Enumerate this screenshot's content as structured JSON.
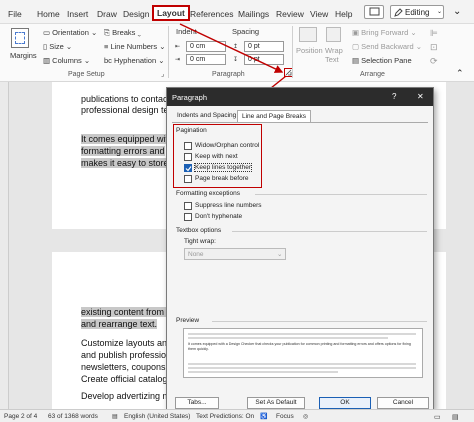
{
  "menu": {
    "items": [
      "File",
      "Home",
      "Insert",
      "Draw",
      "Design",
      "Layout",
      "References",
      "Mailings",
      "Review",
      "View",
      "Help"
    ],
    "active": "Layout",
    "editing_label": "Editing"
  },
  "ribbon": {
    "margins": "Margins",
    "orientation": "Orientation",
    "size": "Size",
    "columns": "Columns",
    "breaks": "Breaks",
    "line_numbers": "Line Numbers",
    "hyphenation": "Hyphenation",
    "page_setup_group": "Page Setup",
    "indent_label": "Indent",
    "spacing_label": "Spacing",
    "indent_left": "0 cm",
    "indent_right": "0 cm",
    "spacing_before": "0 pt",
    "spacing_after": "0 pt",
    "paragraph_group": "Paragraph",
    "position": "Position",
    "wrap_text": "Wrap Text",
    "bring_forward": "Bring Forward",
    "send_backward": "Send Backward",
    "selection_pane": "Selection Pane",
    "arrange_group": "Arrange"
  },
  "document": {
    "page1_lines": [
      "publications to contacts",
      "professional design te",
      "It comes equipped with",
      "formatting errors and",
      "makes it easy to store"
    ],
    "page2_lines": [
      "existing content from o",
      "and rearrange text.",
      "Customize layouts and",
      "and publish profession",
      "newsletters, coupons,",
      "Create official catalogu",
      "Develop advertizing ma"
    ]
  },
  "dialog": {
    "title": "Paragraph",
    "help": "?",
    "close": "✕",
    "tabs": [
      "Indents and Spacing",
      "Line and Page Breaks"
    ],
    "active_tab": "Line and Page Breaks",
    "pagination_label": "Pagination",
    "pagination": [
      {
        "label": "Widow/Orphan control",
        "checked": false
      },
      {
        "label": "Keep with next",
        "checked": false
      },
      {
        "label": "Keep lines together",
        "checked": true
      },
      {
        "label": "Page break before",
        "checked": false
      }
    ],
    "formatting_label": "Formatting exceptions",
    "formatting": [
      {
        "label": "Suppress line numbers",
        "checked": false
      },
      {
        "label": "Don't hyphenate",
        "checked": false
      }
    ],
    "textbox_label": "Textbox options",
    "tight_wrap_label": "Tight wrap:",
    "tight_wrap_value": "None",
    "preview_label": "Preview",
    "preview_text": "It comes equipped with a Design Checker that checks your publication for common printing and formatting errors and offers options for fixing them quickly.",
    "buttons": {
      "tabs": "Tabs...",
      "default": "Set As Default",
      "ok": "OK",
      "cancel": "Cancel"
    }
  },
  "status": {
    "page": "Page 2 of 4",
    "words": "63 of 1368 words",
    "language": "English (United States)",
    "predictions": "Text Predictions: On",
    "focus": "Focus"
  },
  "colors": {
    "highlight_red": "#c00000",
    "accent_blue": "#1a5fb4",
    "title_bar": "#2c2c2c"
  }
}
